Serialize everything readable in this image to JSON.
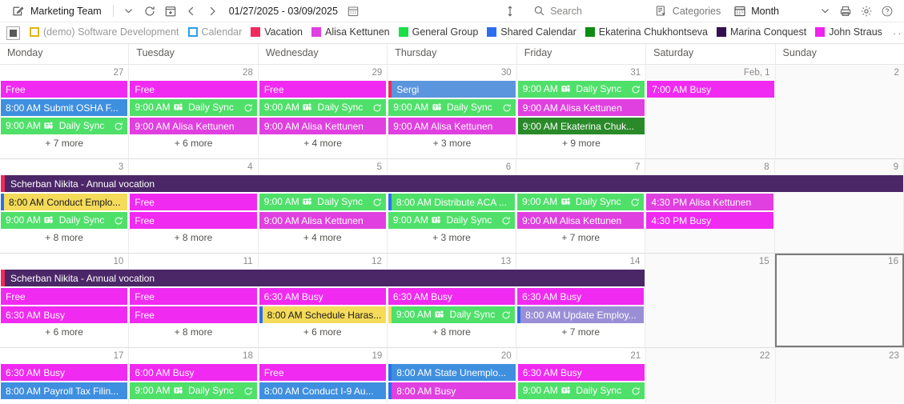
{
  "toolbar": {
    "calendar_name": "Marketing Team",
    "date_range": "01/27/2025 - 03/09/2025",
    "search_placeholder": "Search",
    "categories_label": "Categories",
    "view_label": "Month",
    "icons": {
      "compose": "compose-icon",
      "chevron_down": "chevron-down-icon",
      "refresh": "refresh-icon",
      "today": "today-icon",
      "prev": "chevron-left-icon",
      "next": "chevron-right-icon",
      "date_picker": "calendar-picker-icon",
      "expand": "expand-vertical-icon",
      "search": "search-icon",
      "categories": "categories-icon",
      "month": "month-calendar-icon",
      "view_chevron": "chevron-down-icon",
      "print": "print-icon",
      "settings": "gear-icon",
      "help": "help-icon"
    }
  },
  "legend": {
    "toggle_name": "all-calendars-toggle",
    "overflow_label": "···",
    "items": [
      {
        "label": "(demo) Software Development",
        "color": "#e3b512",
        "hollow": true,
        "muted": true
      },
      {
        "label": "Calendar",
        "color": "#2f9ee6",
        "hollow": true,
        "muted": true
      },
      {
        "label": "Vacation",
        "color": "#f02a5f",
        "hollow": false,
        "muted": false
      },
      {
        "label": "Alisa Kettunen",
        "color": "#e040e0",
        "hollow": false,
        "muted": false
      },
      {
        "label": "General Group",
        "color": "#19e046",
        "hollow": false,
        "muted": false
      },
      {
        "label": "Shared Calendar",
        "color": "#2a6ff0",
        "hollow": false,
        "muted": false
      },
      {
        "label": "Ekaterina Chukhontseva",
        "color": "#0f8a12",
        "hollow": false,
        "muted": false
      },
      {
        "label": "Marina Conquest",
        "color": "#33104f",
        "hollow": false,
        "muted": false
      },
      {
        "label": "John Straus",
        "color": "#f020f0",
        "hollow": false,
        "muted": false
      }
    ]
  },
  "grid": {
    "day_names": [
      "Monday",
      "Tuesday",
      "Wednesday",
      "Thursday",
      "Friday",
      "Saturday",
      "Sunday"
    ],
    "weeks": [
      {
        "id": "week-1",
        "allday_bars": [],
        "days": [
          {
            "num": "27",
            "weekend": false,
            "selected": false,
            "more": "+ 7 more",
            "events": [
              {
                "text": "Free",
                "bg": "#f02af0",
                "fg": "#ffffff",
                "stripe": "",
                "teams": false,
                "recur": false
              },
              {
                "text": "8:00 AM Submit OSHA F...",
                "bg": "#3f8fe0",
                "fg": "#ffffff",
                "stripe": "",
                "teams": false,
                "recur": false
              },
              {
                "text": "9:00 AM  Daily Sync",
                "bg": "#4fe06a",
                "fg": "#ffffff",
                "stripe": "",
                "teams": true,
                "recur": true
              }
            ]
          },
          {
            "num": "28",
            "weekend": false,
            "selected": false,
            "more": "+ 6 more",
            "events": [
              {
                "text": "Free",
                "bg": "#f02af0",
                "fg": "#ffffff",
                "stripe": "",
                "teams": false,
                "recur": false
              },
              {
                "text": "9:00 AM  Daily Sync",
                "bg": "#4fe06a",
                "fg": "#ffffff",
                "stripe": "",
                "teams": true,
                "recur": true
              },
              {
                "text": "9:00 AM Alisa Kettunen",
                "bg": "#e040e0",
                "fg": "#ffffff",
                "stripe": "",
                "teams": false,
                "recur": false
              }
            ]
          },
          {
            "num": "29",
            "weekend": false,
            "selected": false,
            "more": "+ 4 more",
            "events": [
              {
                "text": "Free",
                "bg": "#f02af0",
                "fg": "#ffffff",
                "stripe": "",
                "teams": false,
                "recur": false
              },
              {
                "text": "9:00 AM  Daily Sync",
                "bg": "#4fe06a",
                "fg": "#ffffff",
                "stripe": "",
                "teams": true,
                "recur": true
              },
              {
                "text": "9:00 AM Alisa Kettunen",
                "bg": "#e040e0",
                "fg": "#ffffff",
                "stripe": "",
                "teams": false,
                "recur": false
              }
            ]
          },
          {
            "num": "30",
            "weekend": false,
            "selected": false,
            "more": "+ 3 more",
            "events": [
              {
                "text": "Sergi",
                "bg": "#5b95dd",
                "fg": "#ffffff",
                "stripe": "#f02a5f",
                "teams": false,
                "recur": false
              },
              {
                "text": "9:00 AM  Daily Sync",
                "bg": "#4fe06a",
                "fg": "#ffffff",
                "stripe": "",
                "teams": true,
                "recur": true
              },
              {
                "text": "9:00 AM Alisa Kettunen",
                "bg": "#e040e0",
                "fg": "#ffffff",
                "stripe": "",
                "teams": false,
                "recur": false
              }
            ]
          },
          {
            "num": "31",
            "weekend": false,
            "selected": false,
            "more": "+ 9 more",
            "events": [
              {
                "text": "9:00 AM  Daily Sync",
                "bg": "#4fe06a",
                "fg": "#ffffff",
                "stripe": "",
                "teams": true,
                "recur": true
              },
              {
                "text": "9:00 AM Alisa Kettunen",
                "bg": "#e040e0",
                "fg": "#ffffff",
                "stripe": "",
                "teams": false,
                "recur": false
              },
              {
                "text": "9:00 AM Ekaterina Chuk...",
                "bg": "#2a8a2a",
                "fg": "#ffffff",
                "stripe": "",
                "teams": false,
                "recur": false
              }
            ]
          },
          {
            "num": "Feb, 1",
            "weekend": true,
            "selected": false,
            "more": "",
            "events": [
              {
                "text": "7:00 AM Busy",
                "bg": "#f02af0",
                "fg": "#ffffff",
                "stripe": "",
                "teams": false,
                "recur": false
              }
            ]
          },
          {
            "num": "2",
            "weekend": true,
            "selected": false,
            "more": "",
            "events": []
          }
        ]
      },
      {
        "id": "week-2",
        "allday_bars": [
          {
            "label": "Scherban Nikita - Annual vocation",
            "bg": "#4b2767",
            "stripe": "#f02a5f",
            "start_col": 0,
            "span": 7
          }
        ],
        "days": [
          {
            "num": "3",
            "weekend": false,
            "selected": false,
            "more": "+ 8 more",
            "events": [
              {
                "text": "8:00 AM Conduct Emplo...",
                "bg": "#f5db5a",
                "fg": "#1b1a19",
                "stripe": "#2a6ff0",
                "teams": false,
                "recur": false
              },
              {
                "text": "9:00 AM  Daily Sync",
                "bg": "#4fe06a",
                "fg": "#ffffff",
                "stripe": "",
                "teams": true,
                "recur": true
              }
            ]
          },
          {
            "num": "4",
            "weekend": false,
            "selected": false,
            "more": "+ 8 more",
            "events": [
              {
                "text": "Free",
                "bg": "#f02af0",
                "fg": "#ffffff",
                "stripe": "",
                "teams": false,
                "recur": false
              },
              {
                "text": "Free",
                "bg": "#f02af0",
                "fg": "#ffffff",
                "stripe": "",
                "teams": false,
                "recur": false
              }
            ]
          },
          {
            "num": "5",
            "weekend": false,
            "selected": false,
            "more": "+ 4 more",
            "events": [
              {
                "text": "9:00 AM  Daily Sync",
                "bg": "#4fe06a",
                "fg": "#ffffff",
                "stripe": "",
                "teams": true,
                "recur": true
              },
              {
                "text": "9:00 AM Alisa Kettunen",
                "bg": "#e040e0",
                "fg": "#ffffff",
                "stripe": "",
                "teams": false,
                "recur": false
              }
            ]
          },
          {
            "num": "6",
            "weekend": false,
            "selected": false,
            "more": "+ 3 more",
            "events": [
              {
                "text": "8:00 AM Distribute ACA ...",
                "bg": "#4fe06a",
                "fg": "#ffffff",
                "stripe": "#2a6ff0",
                "teams": false,
                "recur": false
              },
              {
                "text": "9:00 AM  Daily Sync",
                "bg": "#4fe06a",
                "fg": "#ffffff",
                "stripe": "",
                "teams": true,
                "recur": true
              }
            ]
          },
          {
            "num": "7",
            "weekend": false,
            "selected": false,
            "more": "+ 7 more",
            "events": [
              {
                "text": "9:00 AM  Daily Sync",
                "bg": "#4fe06a",
                "fg": "#ffffff",
                "stripe": "",
                "teams": true,
                "recur": true
              },
              {
                "text": "9:00 AM Alisa Kettunen",
                "bg": "#e040e0",
                "fg": "#ffffff",
                "stripe": "",
                "teams": false,
                "recur": false
              }
            ]
          },
          {
            "num": "8",
            "weekend": true,
            "selected": false,
            "more": "",
            "events": [
              {
                "text": "4:30 PM Alisa Kettunen",
                "bg": "#e040e0",
                "fg": "#ffffff",
                "stripe": "",
                "teams": false,
                "recur": false
              },
              {
                "text": "4:30 PM Busy",
                "bg": "#f02af0",
                "fg": "#ffffff",
                "stripe": "",
                "teams": false,
                "recur": false
              }
            ]
          },
          {
            "num": "9",
            "weekend": true,
            "selected": false,
            "more": "",
            "events": []
          }
        ]
      },
      {
        "id": "week-3",
        "allday_bars": [
          {
            "label": "Scherban Nikita - Annual vocation",
            "bg": "#4b2767",
            "stripe": "#f02a5f",
            "start_col": 0,
            "span": 5
          }
        ],
        "days": [
          {
            "num": "10",
            "weekend": false,
            "selected": false,
            "more": "+ 6 more",
            "events": [
              {
                "text": "Free",
                "bg": "#f02af0",
                "fg": "#ffffff",
                "stripe": "",
                "teams": false,
                "recur": false
              },
              {
                "text": "6:30 AM Busy",
                "bg": "#f02af0",
                "fg": "#ffffff",
                "stripe": "",
                "teams": false,
                "recur": false
              }
            ]
          },
          {
            "num": "11",
            "weekend": false,
            "selected": false,
            "more": "+ 8 more",
            "events": [
              {
                "text": "Free",
                "bg": "#f02af0",
                "fg": "#ffffff",
                "stripe": "",
                "teams": false,
                "recur": false
              },
              {
                "text": "Free",
                "bg": "#f02af0",
                "fg": "#ffffff",
                "stripe": "",
                "teams": false,
                "recur": false
              }
            ]
          },
          {
            "num": "12",
            "weekend": false,
            "selected": false,
            "more": "+ 6 more",
            "events": [
              {
                "text": "6:30 AM Busy",
                "bg": "#f02af0",
                "fg": "#ffffff",
                "stripe": "",
                "teams": false,
                "recur": false
              },
              {
                "text": "8:00 AM Schedule Haras...",
                "bg": "#f5db5a",
                "fg": "#1b1a19",
                "stripe": "#2a6ff0",
                "teams": false,
                "recur": false
              }
            ]
          },
          {
            "num": "13",
            "weekend": false,
            "selected": false,
            "more": "+ 8 more",
            "events": [
              {
                "text": "6:30 AM Busy",
                "bg": "#f02af0",
                "fg": "#ffffff",
                "stripe": "",
                "teams": false,
                "recur": false
              },
              {
                "text": "9:00 AM  Daily Sync",
                "bg": "#4fe06a",
                "fg": "#ffffff",
                "stripe": "#f5db5a",
                "teams": true,
                "recur": true
              }
            ]
          },
          {
            "num": "14",
            "weekend": false,
            "selected": false,
            "more": "+ 7 more",
            "events": [
              {
                "text": "6:30 AM Busy",
                "bg": "#f02af0",
                "fg": "#ffffff",
                "stripe": "",
                "teams": false,
                "recur": false
              },
              {
                "text": "8:00 AM Update Employ...",
                "bg": "#9a8fd6",
                "fg": "#ffffff",
                "stripe": "#2a6ff0",
                "teams": false,
                "recur": false
              }
            ]
          },
          {
            "num": "15",
            "weekend": true,
            "selected": false,
            "more": "",
            "events": []
          },
          {
            "num": "16",
            "weekend": true,
            "selected": true,
            "more": "",
            "events": []
          }
        ]
      },
      {
        "id": "week-4",
        "allday_bars": [],
        "days": [
          {
            "num": "17",
            "weekend": false,
            "selected": false,
            "more": "",
            "events": [
              {
                "text": "6:30 AM Busy",
                "bg": "#f02af0",
                "fg": "#ffffff",
                "stripe": "",
                "teams": false,
                "recur": false
              },
              {
                "text": "8:00 AM Payroll Tax Filin...",
                "bg": "#3f8fe0",
                "fg": "#ffffff",
                "stripe": "",
                "teams": false,
                "recur": false
              }
            ]
          },
          {
            "num": "18",
            "weekend": false,
            "selected": false,
            "more": "",
            "events": [
              {
                "text": "6:00 AM Busy",
                "bg": "#f02af0",
                "fg": "#ffffff",
                "stripe": "",
                "teams": false,
                "recur": false
              },
              {
                "text": "9:00 AM  Daily Sync",
                "bg": "#4fe06a",
                "fg": "#ffffff",
                "stripe": "",
                "teams": true,
                "recur": true
              }
            ]
          },
          {
            "num": "19",
            "weekend": false,
            "selected": false,
            "more": "",
            "events": [
              {
                "text": "Free",
                "bg": "#f02af0",
                "fg": "#ffffff",
                "stripe": "",
                "teams": false,
                "recur": false
              },
              {
                "text": "8:00 AM Conduct I-9 Au...",
                "bg": "#3f8fe0",
                "fg": "#ffffff",
                "stripe": "",
                "teams": false,
                "recur": false
              }
            ]
          },
          {
            "num": "20",
            "weekend": false,
            "selected": false,
            "more": "",
            "events": [
              {
                "text": "8:00 AM State Unemplo...",
                "bg": "#3f8fe0",
                "fg": "#ffffff",
                "stripe": "#2a6ff0",
                "teams": false,
                "recur": false
              },
              {
                "text": "8:00 AM Busy",
                "bg": "#e040e0",
                "fg": "#ffffff",
                "stripe": "#2a6ff0",
                "teams": false,
                "recur": false
              }
            ]
          },
          {
            "num": "21",
            "weekend": false,
            "selected": false,
            "more": "",
            "events": [
              {
                "text": "6:30 AM Busy",
                "bg": "#f02af0",
                "fg": "#ffffff",
                "stripe": "",
                "teams": false,
                "recur": false
              },
              {
                "text": "9:00 AM  Daily Sync",
                "bg": "#4fe06a",
                "fg": "#ffffff",
                "stripe": "",
                "teams": true,
                "recur": true
              }
            ]
          },
          {
            "num": "22",
            "weekend": true,
            "selected": false,
            "more": "",
            "events": []
          },
          {
            "num": "23",
            "weekend": true,
            "selected": false,
            "more": "",
            "events": []
          }
        ]
      }
    ]
  }
}
